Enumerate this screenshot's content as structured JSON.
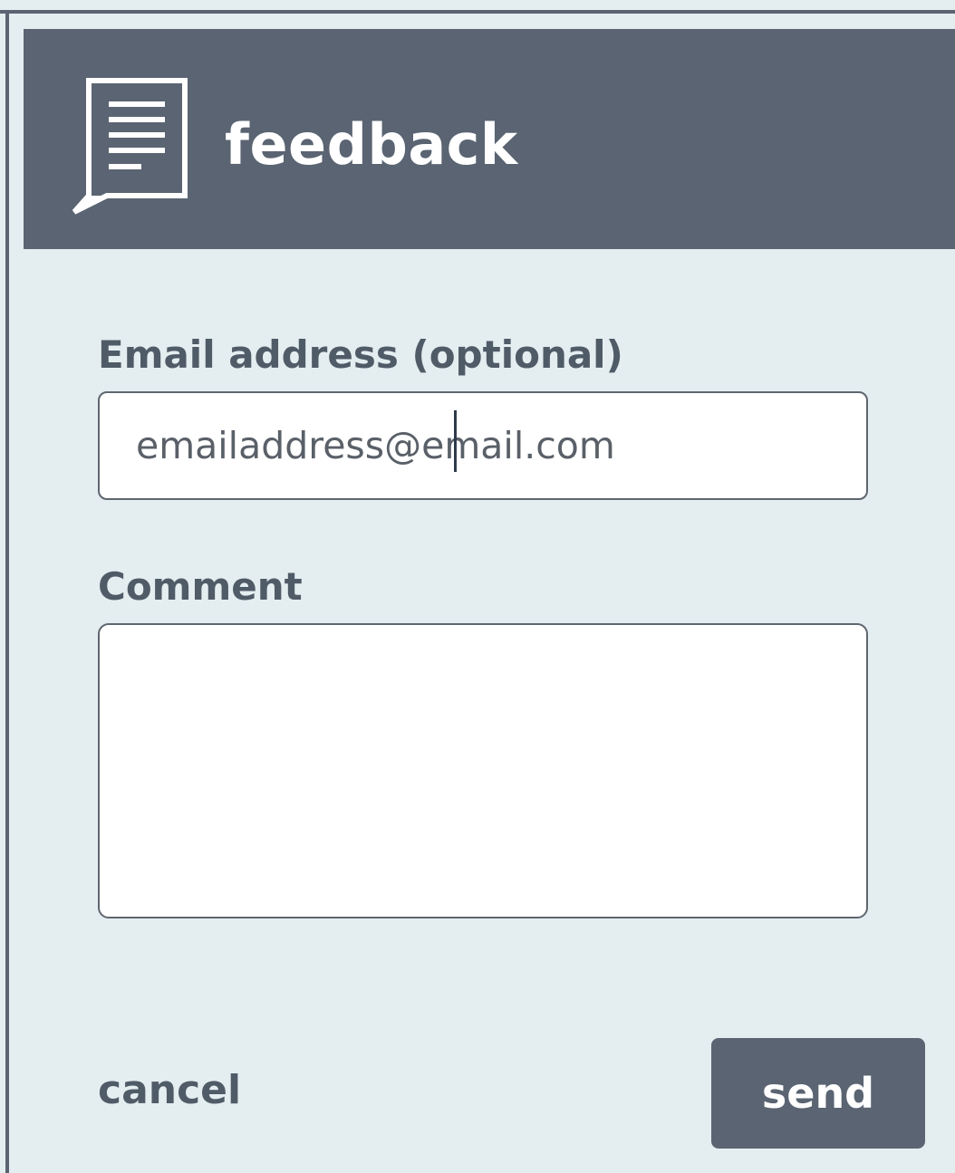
{
  "colors": {
    "header_bg": "#5a6472",
    "page_bg": "#e4eef0",
    "label_text": "#505b68",
    "button_bg": "#5a6472",
    "button_text": "#ffffff"
  },
  "header": {
    "icon": "feedback-document-speech-bubble-icon",
    "title": "feedback"
  },
  "form": {
    "email": {
      "label": "Email address (optional)",
      "value": "emailaddress@email.com"
    },
    "comment": {
      "label": "Comment",
      "value": ""
    }
  },
  "actions": {
    "cancel_label": "cancel",
    "send_label": "send"
  }
}
